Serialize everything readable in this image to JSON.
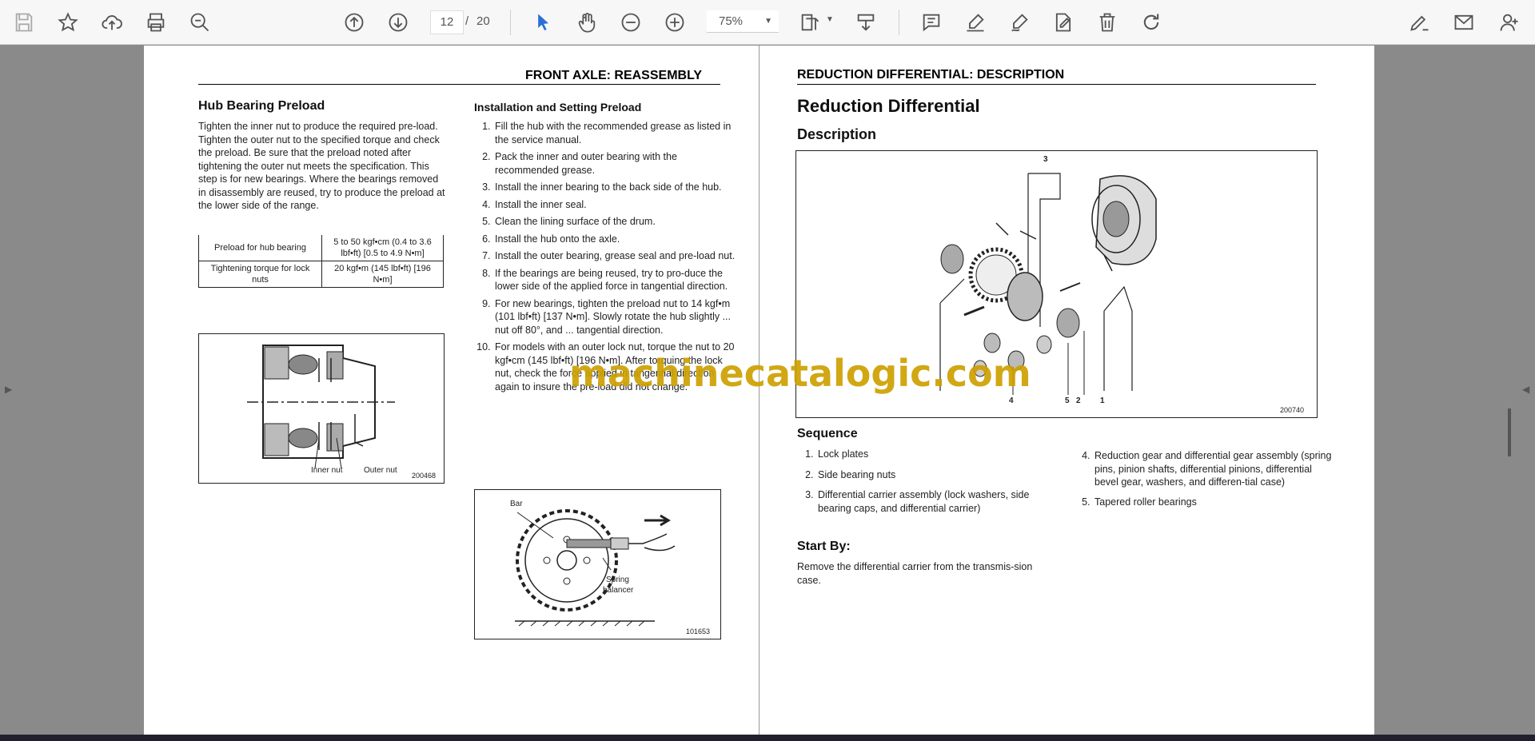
{
  "toolbar": {
    "current_page": "12",
    "page_separator": "/",
    "total_pages": "20",
    "zoom": "75%",
    "icons": [
      "save-icon",
      "bookmark-star-icon",
      "upload-cloud-icon",
      "print-icon",
      "find-zoom-icon",
      "page-up-icon",
      "page-down-icon",
      "select-arrow-icon",
      "hand-pan-icon",
      "zoom-out-icon",
      "zoom-in-icon",
      "fit-page-icon",
      "download-icon",
      "comment-icon",
      "highlight-icon",
      "sign-pen-icon",
      "edit-icon",
      "delete-icon",
      "rotate-icon",
      "share-edit-icon",
      "email-icon",
      "add-user-icon"
    ]
  },
  "left_page": {
    "header": "FRONT AXLE: REASSEMBLY",
    "hub_title": "Hub Bearing Preload",
    "hub_text": "Tighten the inner nut to produce the required pre-load. Tighten the outer nut to the specified torque and check the preload. Be sure that the preload noted after tightening the outer nut meets the specification. This step is for new bearings. Where the bearings removed in disassembly are reused, try to produce the preload at the lower side of the range.",
    "table": [
      {
        "label": "Preload for hub bearing",
        "value": "5 to 50 kgf•cm (0.4 to 3.6 lbf•ft) [0.5 to 4.9 N•m]"
      },
      {
        "label": "Tightening torque for lock nuts",
        "value": "20 kgf•m (145 lbf•ft) [196 N•m]"
      }
    ],
    "fig1_labels": {
      "inner": "Inner nut",
      "outer": "Outer nut",
      "code": "200468"
    },
    "install_title": "Installation and Setting Preload",
    "steps": [
      "Fill the hub with the recommended grease as listed in the service manual.",
      "Pack the inner and outer bearing with the recommended grease.",
      "Install the inner bearing to the back side of the hub.",
      "Install the inner seal.",
      "Clean the lining surface of the drum.",
      "Install the hub onto the axle.",
      "Install the outer bearing, grease seal and pre-load nut.",
      "If the bearings are being reused, try to pro-duce the lower side of the applied force in tangential direction.",
      "For new bearings, tighten the preload nut to 14 kgf•m (101 lbf•ft) [137 N•m]. Slowly rotate the hub slightly ... nut off 80°, and ... tangential direction.",
      "For models with an outer lock nut, torque the nut to 20 kgf•cm (145 lbf•ft) [196 N•m]. After torquing the lock nut, check the force applied in tangential direction again to insure the pre-load did not change."
    ],
    "fig2_labels": {
      "bar": "Bar",
      "spring1": "Spring",
      "spring2": "balancer",
      "code": "101653"
    }
  },
  "right_page": {
    "header": "REDUCTION DIFFERENTIAL: DESCRIPTION",
    "title": "Reduction Differential",
    "subtitle": "Description",
    "fig_labels": {
      "n3": "3",
      "n4": "4",
      "n5": "5",
      "n2": "2",
      "n1": "1",
      "code": "200740"
    },
    "sequence_title": "Sequence",
    "sequence": [
      "Lock plates",
      "Side bearing nuts",
      "Differential carrier assembly (lock washers, side bearing caps, and differential carrier)",
      "Reduction gear and differential gear assembly (spring pins, pinion shafts, differential pinions, differential bevel gear, washers, and differen-tial case)",
      "Tapered roller bearings"
    ],
    "start_title": "Start By:",
    "start_text": "Remove the differential carrier from the transmis-sion case."
  },
  "watermark": "machinecatalogic.com"
}
